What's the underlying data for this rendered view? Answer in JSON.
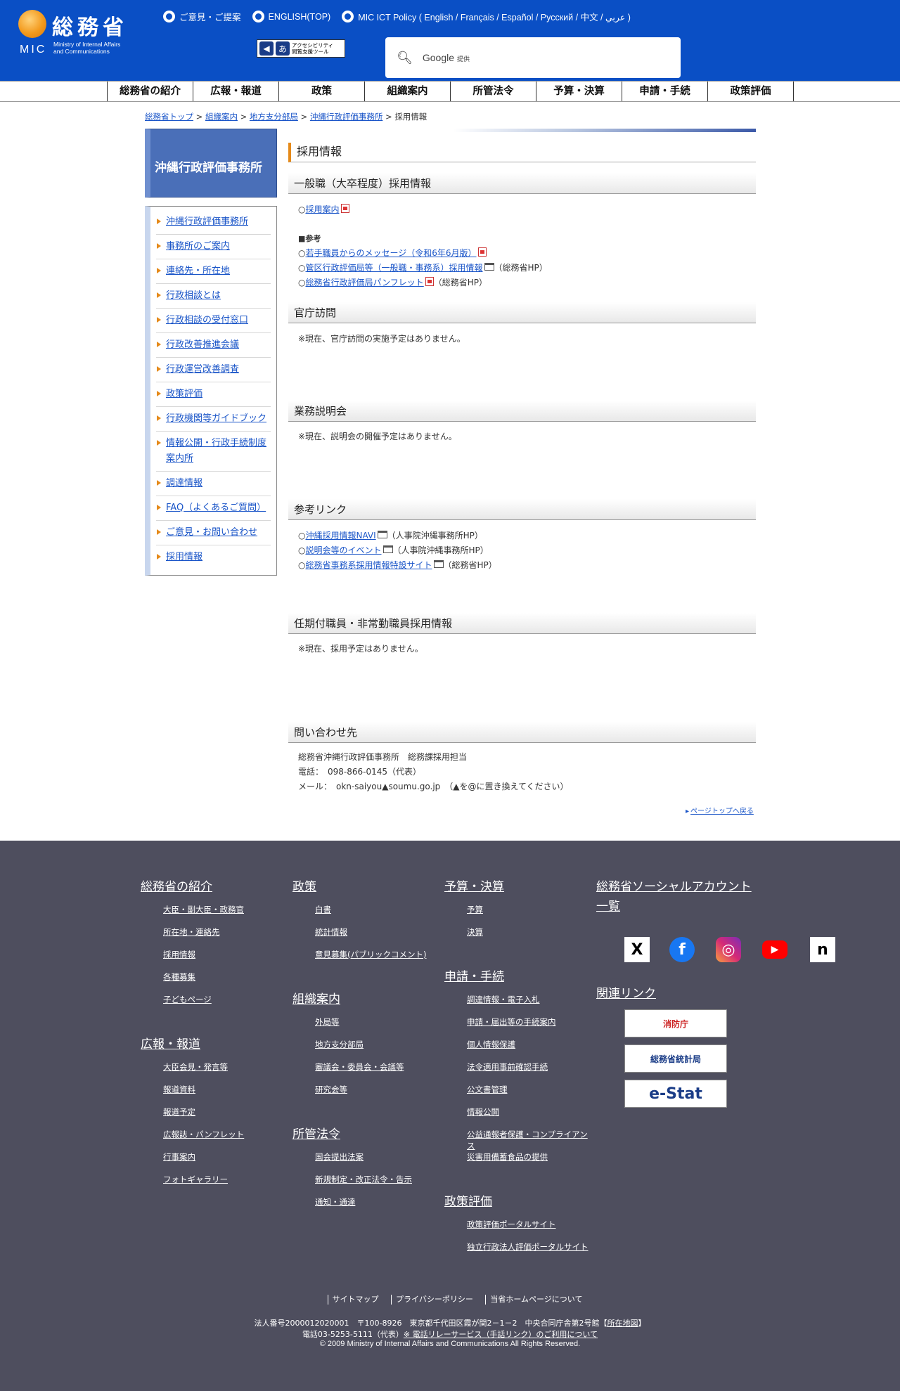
{
  "header": {
    "logo_kanji": "総務省",
    "logo_mic": "MIC",
    "logo_line1": "Ministry of Internal Affairs",
    "logo_line2": "and Communications",
    "top_links": [
      "ご意見・ご提案",
      "ENGLISH(TOP)",
      "MIC ICT Policy ( English / Français / Español / Русский / 中文 / عربي )"
    ],
    "access_tool_line1": "アクセシビリティ",
    "access_tool_line2": "閲覧支援ツール",
    "search_brand": "Google",
    "search_suffix": "提供"
  },
  "main_nav": [
    "総務省の紹介",
    "広報・報道",
    "政策",
    "組織案内",
    "所管法令",
    "予算・決算",
    "申請・手続",
    "政策評価"
  ],
  "breadcrumb": {
    "items": [
      "総務省トップ",
      "組織案内",
      "地方支分部局",
      "沖縄行政評価事務所"
    ],
    "current": "採用情報",
    "sep": " > "
  },
  "sidebar": {
    "title": "沖縄行政評価事務所",
    "items": [
      "沖縄行政評価事務所",
      "事務所のご案内",
      "連絡先・所在地",
      "行政相談とは",
      "行政相談の受付窓口",
      "行政改善推進会議",
      "行政運営改善調査",
      "政策評価",
      "行政機関等ガイドブック",
      "情報公開・行政手続制度案内所",
      "調達情報",
      "FAQ（よくあるご質問）",
      "ご意見・お問い合わせ",
      "採用情報"
    ]
  },
  "content": {
    "page_title": "採用情報",
    "s1_title": "一般職（大卒程度）採用情報",
    "s1_link": "採用案内",
    "s1_ref": "■参考",
    "s1_ref1": "若手職員からのメッセージ（令和6年6月版）",
    "s1_ref2": "管区行政評価局等（一般職・事務系）採用情報",
    "s1_ref2_note": "（総務省HP）",
    "s1_ref3": "総務省行政評価局パンフレット",
    "s1_ref3_note": "（総務省HP）",
    "circle": "○",
    "s2_title": "官庁訪問",
    "s2_text": "※現在、官庁訪問の実施予定はありません。",
    "s3_title": "業務説明会",
    "s3_text": "※現在、説明会の開催予定はありません。",
    "s4_title": "参考リンク",
    "s4_l1": "沖縄採用情報NAVI",
    "s4_l1_note": "（人事院沖縄事務所HP）",
    "s4_l2": "説明会等のイベント",
    "s4_l2_note": "（人事院沖縄事務所HP）",
    "s4_l3": "総務省事務系採用情報特設サイト",
    "s4_l3_note": "（総務省HP）",
    "s5_title": "任期付職員・非常勤職員採用情報",
    "s5_text": "※現在、採用予定はありません。",
    "s6_title": "問い合わせ先",
    "s6_l1": "総務省沖縄行政評価事務所　総務課採用担当",
    "s6_l2": "電話：　098-866-0145（代表）",
    "s6_l3": "メール：　okn-saiyou▲soumu.go.jp　（▲を@に置き換えてください）",
    "page_top": "ページトップへ戻る"
  },
  "footer": {
    "col1_h1": "総務省の紹介",
    "col1_links": [
      "大臣・副大臣・政務官",
      "所在地・連絡先",
      "採用情報",
      "各種募集",
      "子どもページ"
    ],
    "col1_h2": "広報・報道",
    "col1_links2": [
      "大臣会見・発言等",
      "報道資料",
      "報道予定",
      "広報誌・パンフレット",
      "行事案内",
      "フォトギャラリー"
    ],
    "col2_h1": "政策",
    "col2_links": [
      "白書",
      "統計情報",
      "意見募集(パブリックコメント)"
    ],
    "col2_h2": "組織案内",
    "col2_links2": [
      "外局等",
      "地方支分部局",
      "審議会・委員会・会議等",
      "研究会等"
    ],
    "col2_h3": "所管法令",
    "col2_links3": [
      "国会提出法案",
      "新規制定・改正法令・告示",
      "通知・通達"
    ],
    "col3_h1": "予算・決算",
    "col3_links": [
      "予算",
      "決算"
    ],
    "col3_h2": "申請・手続",
    "col3_links2": [
      "調達情報・電子入札",
      "申請・届出等の手続案内",
      "個人情報保護",
      "法令適用事前確認手続",
      "公文書管理",
      "情報公開",
      "公益通報者保護・コンプライアンス",
      "災害用備蓄食品の提供"
    ],
    "col3_h3": "政策評価",
    "col3_links3": [
      "政策評価ポータルサイト",
      "独立行政法人評価ポータルサイト"
    ],
    "col4_h1": "総務省ソーシャルアカウント一覧",
    "col4_h2": "関連リンク",
    "social": [
      "X",
      "f",
      "◎",
      "▶",
      "n"
    ],
    "rel_links": [
      "消防庁",
      "総務省統計局",
      "e-Stat"
    ],
    "bottom_links": [
      "サイトマップ",
      "プライバシーポリシー",
      "当省ホームページについて"
    ],
    "addr1": "法人番号2000012020001　〒100-8926　東京都千代田区霞が関2－1－2　中央合同庁舎第2号館【",
    "addr1_link": "所在地図",
    "addr1_end": "】",
    "addr2": "電話03-5253-5111（代表）",
    "addr2_link": "※ 電話リレーサービス（手話リンク）のご利用について",
    "copyright": "© 2009 Ministry of Internal Affairs and Communications All Rights Reserved."
  }
}
